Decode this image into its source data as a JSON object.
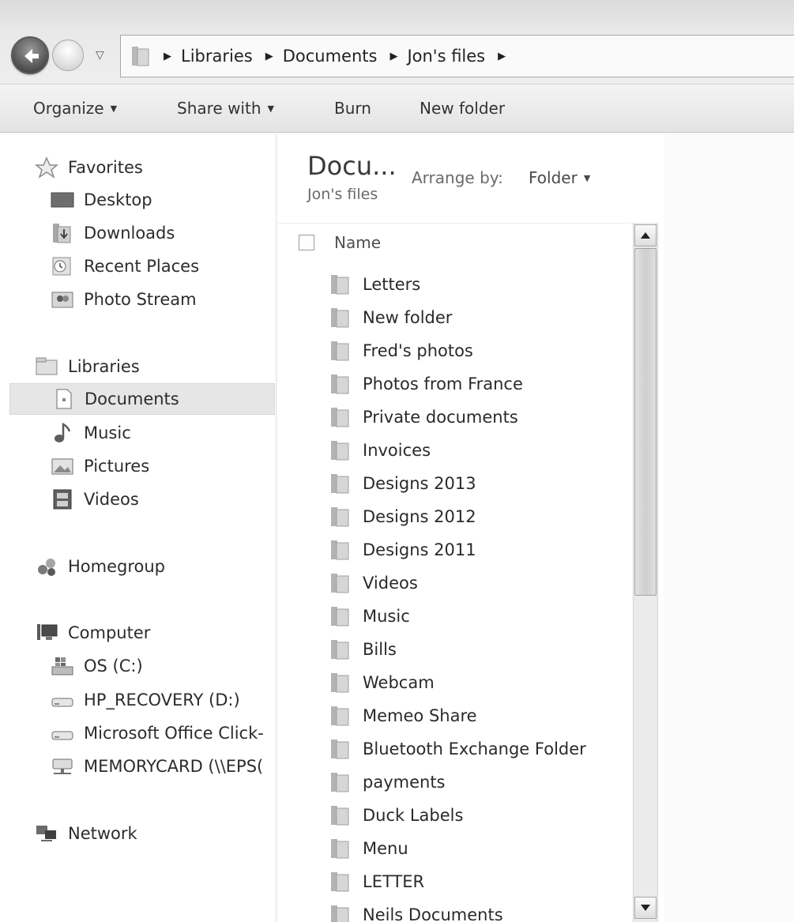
{
  "address_bar": {
    "breadcrumbs": [
      "Libraries",
      "Documents",
      "Jon's files"
    ]
  },
  "toolbar": {
    "organize_label": "Organize",
    "share_label": "Share with",
    "burn_label": "Burn",
    "new_folder_label": "New folder"
  },
  "nav_pane": {
    "favorites": {
      "label": "Favorites",
      "items": [
        {
          "label": "Desktop",
          "icon": "desktop-icon"
        },
        {
          "label": "Downloads",
          "icon": "downloads-icon"
        },
        {
          "label": "Recent Places",
          "icon": "recent-places-icon"
        },
        {
          "label": "Photo Stream",
          "icon": "photo-stream-icon"
        }
      ]
    },
    "libraries": {
      "label": "Libraries",
      "items": [
        {
          "label": "Documents",
          "icon": "documents-icon",
          "selected": true
        },
        {
          "label": "Music",
          "icon": "music-icon"
        },
        {
          "label": "Pictures",
          "icon": "pictures-icon"
        },
        {
          "label": "Videos",
          "icon": "videos-icon"
        }
      ]
    },
    "homegroup": {
      "label": "Homegroup"
    },
    "computer": {
      "label": "Computer",
      "items": [
        {
          "label": "OS (C:)",
          "icon": "os-drive-icon"
        },
        {
          "label": "HP_RECOVERY (D:)",
          "icon": "drive-icon"
        },
        {
          "label": "Microsoft Office Click-",
          "icon": "drive-icon"
        },
        {
          "label": "MEMORYCARD (\\\\EPS(",
          "icon": "network-drive-icon"
        }
      ]
    },
    "network": {
      "label": "Network"
    }
  },
  "content": {
    "library_title": "Docu...",
    "library_subtitle": "Jon's files",
    "arrange_label": "Arrange by:",
    "arrange_value": "Folder",
    "column_name": "Name",
    "files": [
      "Letters",
      "New folder",
      "Fred's photos",
      "Photos from France",
      "Private documents",
      "Invoices",
      "Designs 2013",
      "Designs 2012",
      "Designs 2011",
      "Videos",
      "Music",
      "Bills",
      "Webcam",
      "Memeo Share",
      "Bluetooth Exchange Folder",
      "payments",
      "Duck Labels",
      "Menu",
      "LETTER",
      "Neils Documents"
    ]
  }
}
